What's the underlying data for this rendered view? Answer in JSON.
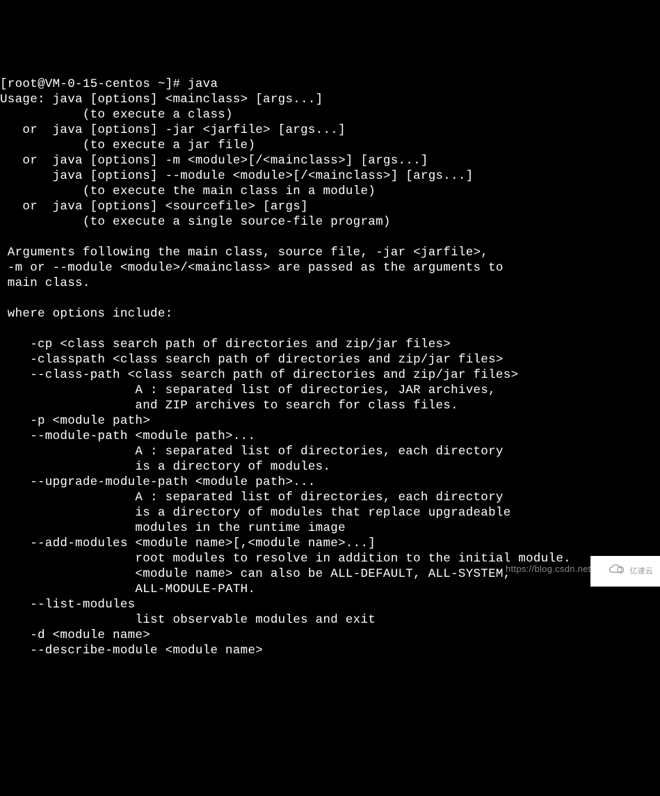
{
  "terminal": {
    "lines": [
      "[root@VM-0-15-centos ~]# java",
      "Usage: java [options] <mainclass> [args...]",
      "           (to execute a class)",
      "   or  java [options] -jar <jarfile> [args...]",
      "           (to execute a jar file)",
      "   or  java [options] -m <module>[/<mainclass>] [args...]",
      "       java [options] --module <module>[/<mainclass>] [args...]",
      "           (to execute the main class in a module)",
      "   or  java [options] <sourcefile> [args]",
      "           (to execute a single source-file program)",
      "",
      " Arguments following the main class, source file, -jar <jarfile>,",
      " -m or --module <module>/<mainclass> are passed as the arguments to",
      " main class.",
      "",
      " where options include:",
      "",
      "    -cp <class search path of directories and zip/jar files>",
      "    -classpath <class search path of directories and zip/jar files>",
      "    --class-path <class search path of directories and zip/jar files>",
      "                  A : separated list of directories, JAR archives,",
      "                  and ZIP archives to search for class files.",
      "    -p <module path>",
      "    --module-path <module path>...",
      "                  A : separated list of directories, each directory",
      "                  is a directory of modules.",
      "    --upgrade-module-path <module path>...",
      "                  A : separated list of directories, each directory",
      "                  is a directory of modules that replace upgradeable",
      "                  modules in the runtime image",
      "    --add-modules <module name>[,<module name>...]",
      "                  root modules to resolve in addition to the initial module.",
      "                  <module name> can also be ALL-DEFAULT, ALL-SYSTEM,",
      "                  ALL-MODULE-PATH.",
      "    --list-modules",
      "                  list observable modules and exit",
      "    -d <module name>",
      "    --describe-module <module name>"
    ]
  },
  "watermark": {
    "url": "https://blog.csdn.net/weixi",
    "brand": "亿速云"
  }
}
